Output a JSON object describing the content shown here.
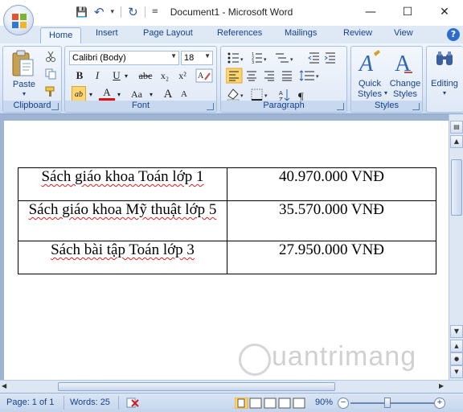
{
  "window": {
    "title": "Document1 - Microsoft Word",
    "minimize": "—",
    "maximize": "☐",
    "close": "✕"
  },
  "qat": {
    "save": "💾",
    "undo": "↶",
    "undo_dd": "▾",
    "redo": "↻",
    "customize": "≡"
  },
  "tabs": [
    "Home",
    "Insert",
    "Page Layout",
    "References",
    "Mailings",
    "Review",
    "View"
  ],
  "help": "?",
  "ribbon": {
    "clipboard": {
      "label": "Clipboard",
      "paste": "Paste"
    },
    "font": {
      "label": "Font",
      "name": "Calibri (Body)",
      "size": "18",
      "bold": "B",
      "italic": "I",
      "underline": "U",
      "strike": "abc",
      "subscript": "x₂",
      "superscript": "x²",
      "case": "Aa",
      "grow": "A",
      "shrink": "A"
    },
    "paragraph": {
      "label": "Paragraph"
    },
    "styles": {
      "label": "Styles",
      "quick_styles": "Quick Styles",
      "change_styles": "Change Styles"
    },
    "editing": {
      "label": "Editing"
    }
  },
  "document": {
    "rows": [
      {
        "item": "Sách giáo khoa Toán lớp 1",
        "price": "40.970.000 VNĐ"
      },
      {
        "item": "Sách giáo khoa Mỹ thuật lớp 5",
        "price": "35.570.000 VNĐ"
      },
      {
        "item": "Sách bài tập Toán lớp 3",
        "price": "27.950.000 VNĐ"
      }
    ]
  },
  "watermark": "uantrimang",
  "status": {
    "page": "Page: 1 of 1",
    "words": "Words: 25",
    "zoom": "90%",
    "zoom_minus": "−",
    "zoom_plus": "+"
  },
  "colors": {
    "ribbon_bg": "#dbe6f5",
    "accent": "#15428b",
    "highlight": "#ffd66e"
  }
}
